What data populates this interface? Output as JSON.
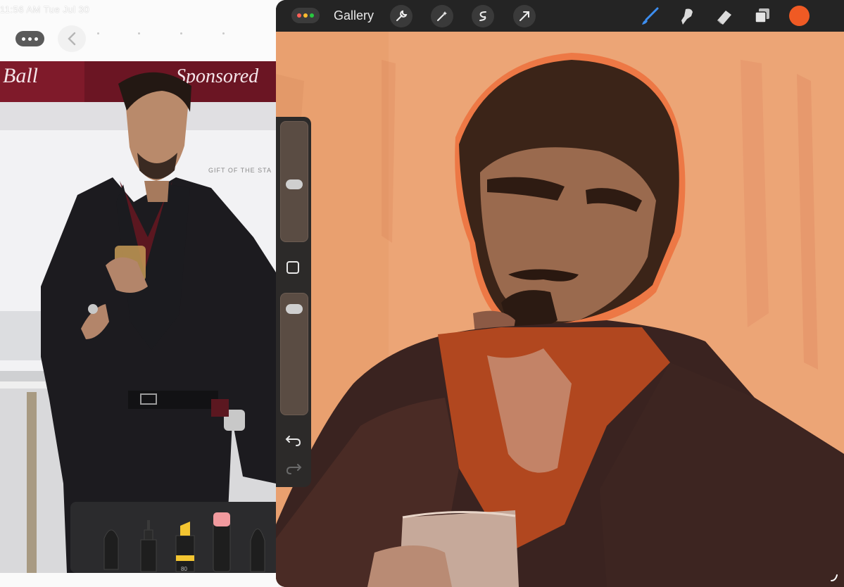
{
  "left_app": {
    "title": "11:56 AM  Tue Jul 30"
  },
  "reference_photo": {
    "banner_left": "Ball",
    "banner_right": "Sponsored",
    "wall_text": "GIFT OF THE STA"
  },
  "pencil_tray": {
    "tools": [
      "pen",
      "fineliner",
      "marker",
      "eraser",
      "crayon"
    ],
    "marker_width_label": "80"
  },
  "procreate": {
    "gallery_label": "Gallery",
    "actions": [
      "wrench-icon",
      "magic-wand-icon",
      "selection-icon",
      "transform-arrow-icon"
    ],
    "tools": [
      "brush-icon",
      "smudge-icon",
      "eraser-icon",
      "layers-icon"
    ],
    "current_color": "#ef5a24",
    "traffic_colors": [
      "#ff5f57",
      "#febc2e",
      "#28c840"
    ],
    "brush_size_level": 0.53,
    "opacity_level": 0.06
  }
}
